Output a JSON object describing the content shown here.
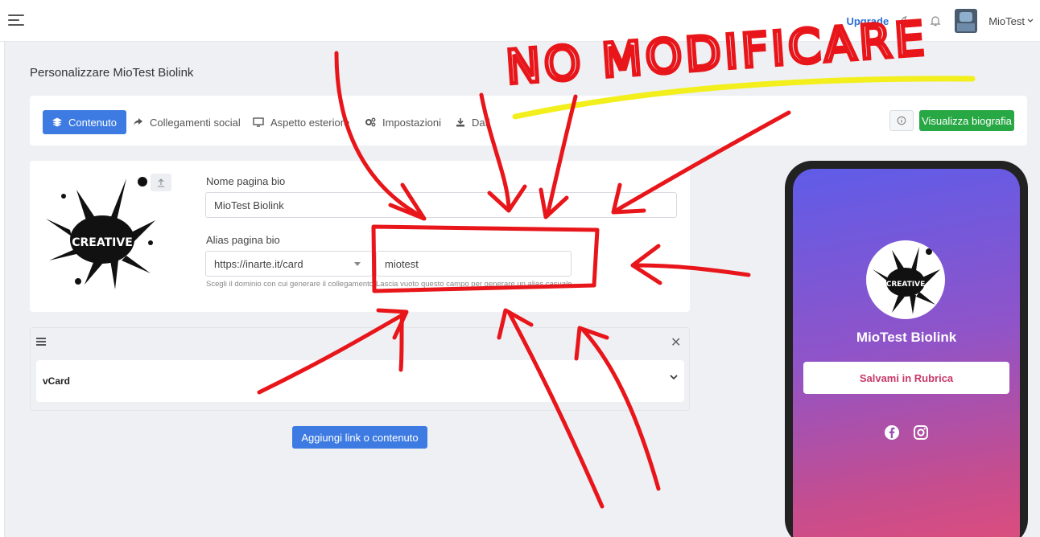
{
  "topbar": {
    "upgrade_label": "Upgrade",
    "user_name": "MioTest"
  },
  "page": {
    "title": "Personalizzare MioTest Biolink"
  },
  "tabs": [
    {
      "label": "Contenuto",
      "icon": "layers-icon",
      "active": true
    },
    {
      "label": "Collegamenti social",
      "icon": "share-icon",
      "active": false
    },
    {
      "label": "Aspetto esteriore",
      "icon": "monitor-icon",
      "active": false
    },
    {
      "label": "Impostazioni",
      "icon": "gears-icon",
      "active": false
    },
    {
      "label": "Dati",
      "icon": "download-icon",
      "active": false
    }
  ],
  "actions": {
    "view_bio_label": "Visualizza biografia"
  },
  "profile": {
    "logo_text": "CREATIVE",
    "name_label": "Nome pagina bio",
    "name_value": "MioTest Biolink",
    "alias_label": "Alias pagina bio",
    "domain_value": "https://inarte.it/card",
    "alias_value": "miotest",
    "domain_help": "Scegli il dominio con cui generare il collegamento.",
    "alias_help": "Lascia vuoto questo campo per generare un alias casuale."
  },
  "blocks": [
    {
      "label": "vCard"
    }
  ],
  "add_content_label": "Aggiungi link o contenuto",
  "preview": {
    "name": "MioTest Biolink",
    "save_button": "Salvami in Rubrica",
    "social_icons": [
      "facebook-icon",
      "instagram-icon"
    ]
  },
  "annotation": {
    "text": "NO MODIFICARE",
    "color": "#e8161a",
    "underline_color": "#f2ef1c"
  }
}
